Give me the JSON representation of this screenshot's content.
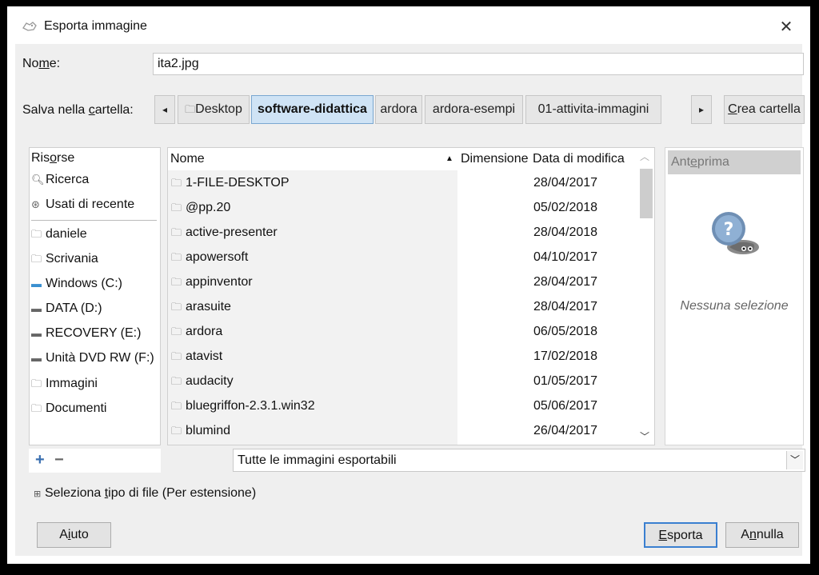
{
  "window": {
    "title": "Esporta immagine",
    "close_glyph": "✕"
  },
  "name_field": {
    "label_pre": "No",
    "label_u": "m",
    "label_post": "e:",
    "value": "ita2.jpg"
  },
  "folder": {
    "label_pre": "Salva nella ",
    "label_u": "c",
    "label_post": "artella:",
    "nav_left": "◂",
    "nav_right": "▸",
    "path": [
      "Desktop",
      "software-didattica",
      "ardora",
      "ardora-esempi",
      "01-attivita-immagini"
    ],
    "active_index": 1,
    "create_pre": "",
    "create_u": "C",
    "create_post": "rea cartella"
  },
  "places": {
    "header_pre": "Ris",
    "header_u": "o",
    "header_post": "rse",
    "items": [
      {
        "label": "Ricerca",
        "icon": "search-icon"
      },
      {
        "label": "Usati di recente",
        "icon": "recent-icon"
      },
      {
        "label": "daniele",
        "icon": "folder-icon"
      },
      {
        "label": "Scrivania",
        "icon": "folder-icon"
      },
      {
        "label": "Windows (C:)",
        "icon": "drive-icon"
      },
      {
        "label": "DATA (D:)",
        "icon": "drive-icon"
      },
      {
        "label": "RECOVERY (E:)",
        "icon": "drive-icon"
      },
      {
        "label": "Unità DVD RW (F:)",
        "icon": "dvd-icon"
      },
      {
        "label": "Immagini",
        "icon": "folder-icon"
      },
      {
        "label": "Documenti",
        "icon": "folder-icon"
      }
    ],
    "add": "+",
    "remove": "−"
  },
  "filelist": {
    "columns": {
      "name": "Nome",
      "size": "Dimensione",
      "date": "Data di modifica"
    },
    "sort_glyph": "▲",
    "rows": [
      {
        "name": "1-FILE-DESKTOP",
        "date": "28/04/2017"
      },
      {
        "name": "@pp.20",
        "date": "05/02/2018"
      },
      {
        "name": "active-presenter",
        "date": "28/04/2018"
      },
      {
        "name": "apowersoft",
        "date": "04/10/2017"
      },
      {
        "name": "appinventor",
        "date": "28/04/2017"
      },
      {
        "name": "arasuite",
        "date": "28/04/2017"
      },
      {
        "name": "ardora",
        "date": "06/05/2018"
      },
      {
        "name": "atavist",
        "date": "17/02/2018"
      },
      {
        "name": "audacity",
        "date": "01/05/2017"
      },
      {
        "name": "bluegriffon-2.3.1.win32",
        "date": "05/06/2017"
      },
      {
        "name": "blumind",
        "date": "26/04/2017"
      }
    ]
  },
  "preview": {
    "header_pre": "Ant",
    "header_u": "e",
    "header_post": "prima",
    "empty_text": "Nessuna selezione"
  },
  "filter": {
    "selected": "Tutte le immagini esportabili"
  },
  "filetype": {
    "label_pre": "Seleziona ",
    "label_u": "t",
    "label_post": "ipo di file (Per estensione)"
  },
  "buttons": {
    "help_pre": "A",
    "help_u": "i",
    "help_post": "uto",
    "export_pre": "",
    "export_u": "E",
    "export_post": "sporta",
    "cancel_pre": "A",
    "cancel_u": "n",
    "cancel_post": "nulla"
  },
  "colors": {
    "accent": "#3a7fd0",
    "active_path_bg": "#cfe3f5"
  }
}
